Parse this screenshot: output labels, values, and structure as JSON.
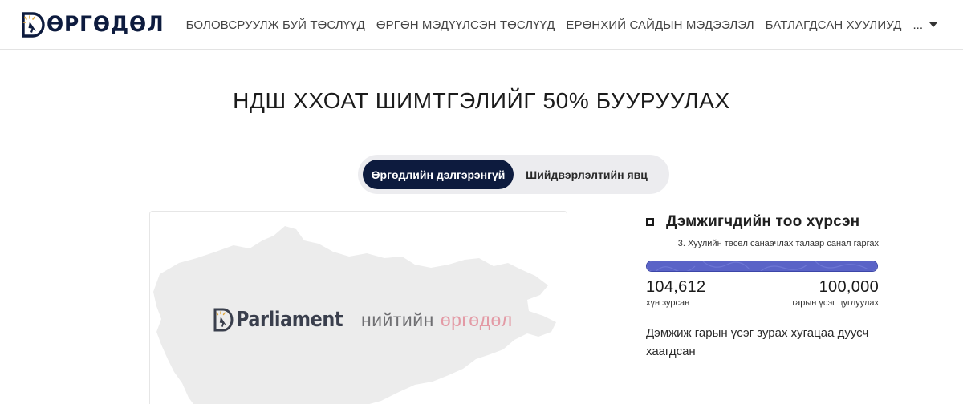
{
  "header": {
    "logo_text": "ӨРГӨДӨЛ",
    "nav": [
      "БОЛОВСРУУЛЖ БУЙ ТӨСЛҮҮД",
      "ӨРГӨН МЭДҮҮЛСЭН ТӨСЛҮҮД",
      "ЕРӨНХИЙ САЙДЫН МЭДЭЭЛЭЛ",
      "БАТЛАГДСАН ХУУЛИУД"
    ],
    "more_label": "..."
  },
  "page": {
    "title": "НДШ ХХОАТ ШИМТГЭЛИЙГ 50% БУУРУУЛАХ"
  },
  "tabs": [
    {
      "label": "Өргөдлийн дэлгэрэнгүй",
      "active": true
    },
    {
      "label": "Шийдвэрлэлтийн явц",
      "active": false
    }
  ],
  "image_card": {
    "brand_en": "Parliament",
    "brand_mn_1": "нийтийн",
    "brand_mn_2": "өргөдөл"
  },
  "stats": {
    "status_title": "Дэмжигчдийн тоо хүрсэн",
    "stage": "3. Хуулийн төсөл санаачлах талаар санал гаргах",
    "progress_fraction": 1.0,
    "signed_count": "104,612",
    "signed_label": "хүн зурсан",
    "goal_count": "100,000",
    "goal_label": "гарын үсэг цуглуулах",
    "note": "Дэмжиж гарын үсэг зурах хугацаа дуусч хаагдсан"
  },
  "colors": {
    "brand_navy": "#0d1b3e",
    "progress": "#5a63c7",
    "accent_pink": "#e39aa5"
  }
}
